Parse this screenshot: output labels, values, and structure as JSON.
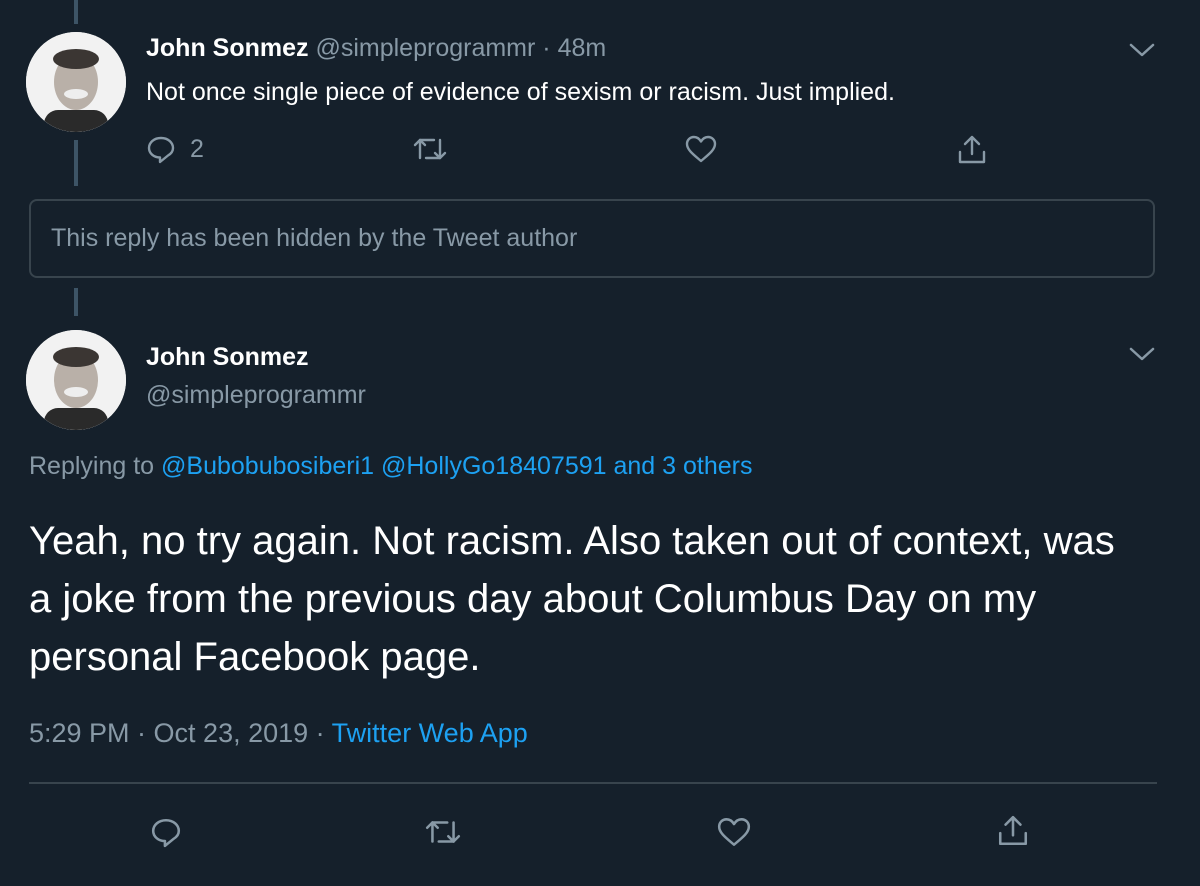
{
  "tweet1": {
    "author_name": "John Sonmez",
    "handle": "@simpleprogrammr",
    "separator": "·",
    "time": "48m",
    "text": "Not once single piece of evidence of sexism or racism. Just implied.",
    "reply_count": "2"
  },
  "hidden_reply": {
    "text": "This reply has been hidden by the Tweet author"
  },
  "tweet2": {
    "author_name": "John Sonmez",
    "handle": "@simpleprogrammr",
    "replying_prefix": "Replying to",
    "replying_links": "@Bubobubosiberi1 @HollyGo18407591 and 3 others",
    "text": "Yeah, no try again. Not racism. Also taken out of context, was a joke from the previous day about Columbus Day on my personal Facebook page.",
    "time": "5:29 PM · Oct 23, 2019 ·",
    "source": "Twitter Web App"
  },
  "icons": {
    "reply": "reply-icon",
    "retweet": "retweet-icon",
    "like": "heart-icon",
    "share": "share-icon",
    "more": "chevron-down-icon"
  },
  "colors": {
    "background": "#15202b",
    "text": "#ffffff",
    "muted": "#8899a6",
    "link": "#1da1f2",
    "border": "#38444d"
  }
}
